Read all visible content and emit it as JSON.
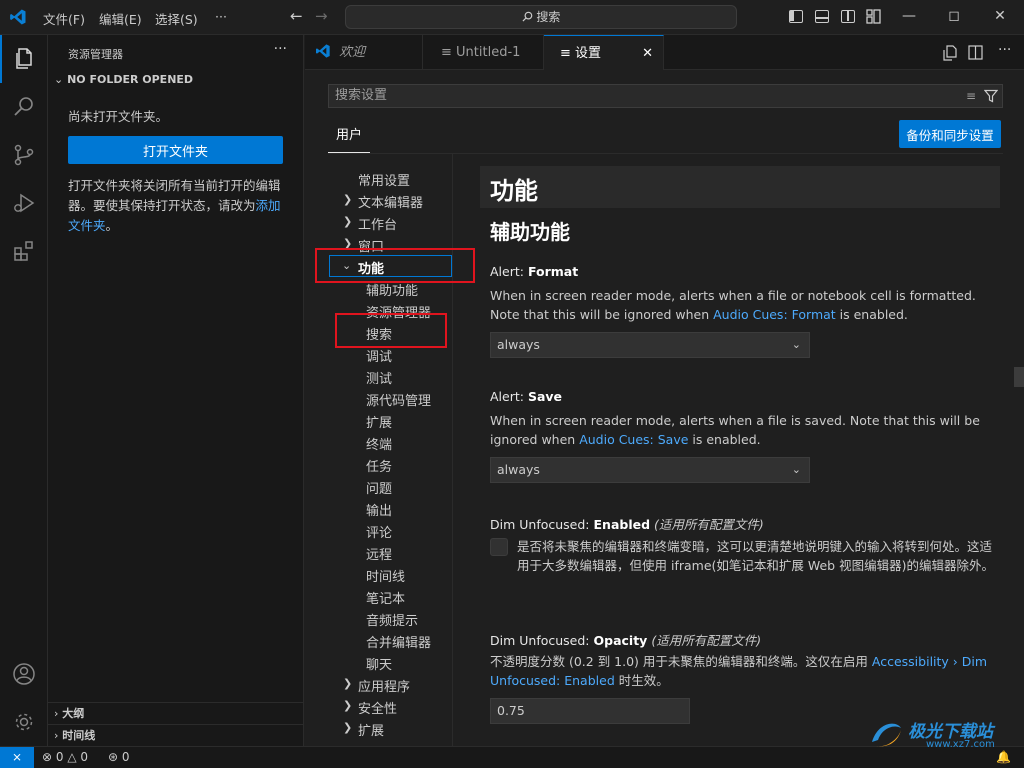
{
  "menu": {
    "file": "文件(F)",
    "edit": "编辑(E)",
    "selection": "选择(S)",
    "more": "···"
  },
  "command_center": {
    "label": "搜索"
  },
  "sidebar": {
    "title": "资源管理器",
    "section": "NO FOLDER OPENED",
    "no_folder_msg": "尚未打开文件夹。",
    "open_folder_label": "打开文件夹",
    "hint_text": "打开文件夹将关闭所有当前打开的编辑器。要使其保持打开状态，请改为",
    "add_folder_link": "添加文件夹",
    "hint_end": "。",
    "outline": "大纲",
    "timeline": "时间线"
  },
  "tabs": [
    {
      "label": "欢迎"
    },
    {
      "label": "Untitled-1"
    },
    {
      "label": "设置"
    }
  ],
  "settings": {
    "search_placeholder": "搜索设置",
    "user_tab": "用户",
    "backup_button": "备份和同步设置",
    "toc": [
      {
        "label": "常用设置"
      },
      {
        "label": "文本编辑器"
      },
      {
        "label": "工作台"
      },
      {
        "label": "窗口"
      },
      {
        "label": "功能"
      },
      {
        "label": "辅助功能"
      },
      {
        "label": "资源管理器"
      },
      {
        "label": "搜索"
      },
      {
        "label": "调试"
      },
      {
        "label": "测试"
      },
      {
        "label": "源代码管理"
      },
      {
        "label": "扩展"
      },
      {
        "label": "终端"
      },
      {
        "label": "任务"
      },
      {
        "label": "问题"
      },
      {
        "label": "输出"
      },
      {
        "label": "评论"
      },
      {
        "label": "远程"
      },
      {
        "label": "时间线"
      },
      {
        "label": "笔记本"
      },
      {
        "label": "音频提示"
      },
      {
        "label": "合并编辑器"
      },
      {
        "label": "聊天"
      },
      {
        "label": "应用程序"
      },
      {
        "label": "安全性"
      },
      {
        "label": "扩展"
      }
    ],
    "section_title": "功能",
    "subsection_title": "辅助功能",
    "items": [
      {
        "title_prefix": "Alert: ",
        "title_bold": "Format",
        "scope": "",
        "desc_before": "When in screen reader mode, alerts when a file or notebook cell is formatted. Note that this will be ignored when ",
        "desc_link": "Audio Cues: Format",
        "desc_after": " is enabled.",
        "value": "always"
      },
      {
        "title_prefix": "Alert: ",
        "title_bold": "Save",
        "scope": "",
        "desc_before": "When in screen reader mode, alerts when a file is saved. Note that this will be ignored when ",
        "desc_link": "Audio Cues: Save",
        "desc_after": " is enabled.",
        "value": "always"
      },
      {
        "title_prefix": "Dim Unfocused: ",
        "title_bold": "Enabled",
        "scope": "(适用所有配置文件)",
        "desc": "是否将未聚焦的编辑器和终端变暗，这可以更清楚地说明键入的输入将转到何处。这适用于大多数编辑器，但使用 iframe(如笔记本和扩展 Web 视图编辑器)的编辑器除外。",
        "checked": false
      },
      {
        "title_prefix": "Dim Unfocused: ",
        "title_bold": "Opacity",
        "scope": "(适用所有配置文件)",
        "desc_before": "不透明度分数 (0.2 到 1.0) 用于未聚焦的编辑器和终端。这仅在启用 ",
        "desc_link": "Accessibility › Dim Unfocused: Enabled",
        "desc_after": " 时生效。",
        "value": "0.75"
      }
    ]
  },
  "statusbar": {
    "errors": "0",
    "warnings": "0",
    "ports": "0"
  },
  "watermark": {
    "text": "极光下载站",
    "url": "www.xz7.com"
  },
  "colors": {
    "accent": "#0078d4",
    "highlight": "#e0141e",
    "link": "#4daafc"
  }
}
